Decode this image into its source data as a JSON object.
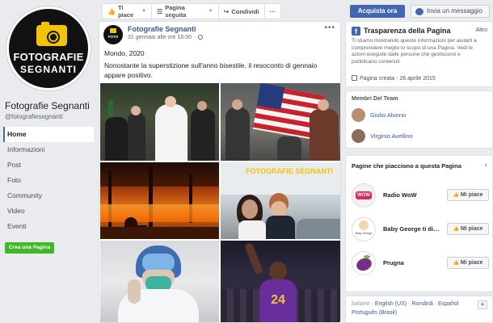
{
  "page": {
    "name": "Fotografie Segnanti",
    "handle": "@fotografiesegnanti",
    "logo_line1": "FOTOGRAFIE",
    "logo_line2": "SEGNANTI"
  },
  "nav": [
    {
      "label": "Home",
      "active": true
    },
    {
      "label": "Informazioni"
    },
    {
      "label": "Post"
    },
    {
      "label": "Foto"
    },
    {
      "label": "Community"
    },
    {
      "label": "Video"
    },
    {
      "label": "Eventi"
    }
  ],
  "create_page_label": "Crea una Pagina",
  "actionbar": {
    "like": "Ti piace",
    "follow": "Pagina seguita",
    "share": "Condividi",
    "more": "···"
  },
  "buy_label": "Acquista ora",
  "message_label": "Invia un messaggio",
  "post": {
    "author": "Fotografie Segnanti",
    "time": "31 gennaio alle ore 16:00 ·",
    "line1": "Mondo, 2020",
    "line2": "Nonostante la superstizione sull'anno bisestile, il resoconto di gennaio appare positivo.",
    "watermark": "FOTOGRAFIE SEGNANTI",
    "jersey_number": "24"
  },
  "transparency": {
    "title": "Trasparenza della Pagina",
    "other": "Altro",
    "desc": "Ti stiamo mostrando queste informazioni per aiutarti a comprendere meglio lo scopo di una Pagina. Vedi le azioni eseguite dalle persone che gestiscono e pubblicano contenuti",
    "created": "Pagina creata - 26 aprile 2015"
  },
  "team": {
    "title": "Membri Del Team",
    "members": [
      "Giulio Alunno",
      "Virginio Avellino"
    ]
  },
  "liked": {
    "title": "Pagine che piacciono a questa Pagina",
    "button_label": "Mi piace",
    "pages": [
      {
        "name": "Radio WoW",
        "logo_text": "WOW"
      },
      {
        "name": "Baby George ti di…",
        "logo_text": "Baby George"
      },
      {
        "name": "Prugna",
        "logo_text": ""
      }
    ]
  },
  "languages": {
    "current": "Italiano",
    "row1": [
      "English (US)",
      "Română",
      "Español"
    ],
    "row2": "Português (Brasil)",
    "plus": "+"
  },
  "colors": {
    "fb_blue": "#4267b2",
    "link": "#385898",
    "green": "#42b72a",
    "logo_yellow": "#f2c500"
  }
}
